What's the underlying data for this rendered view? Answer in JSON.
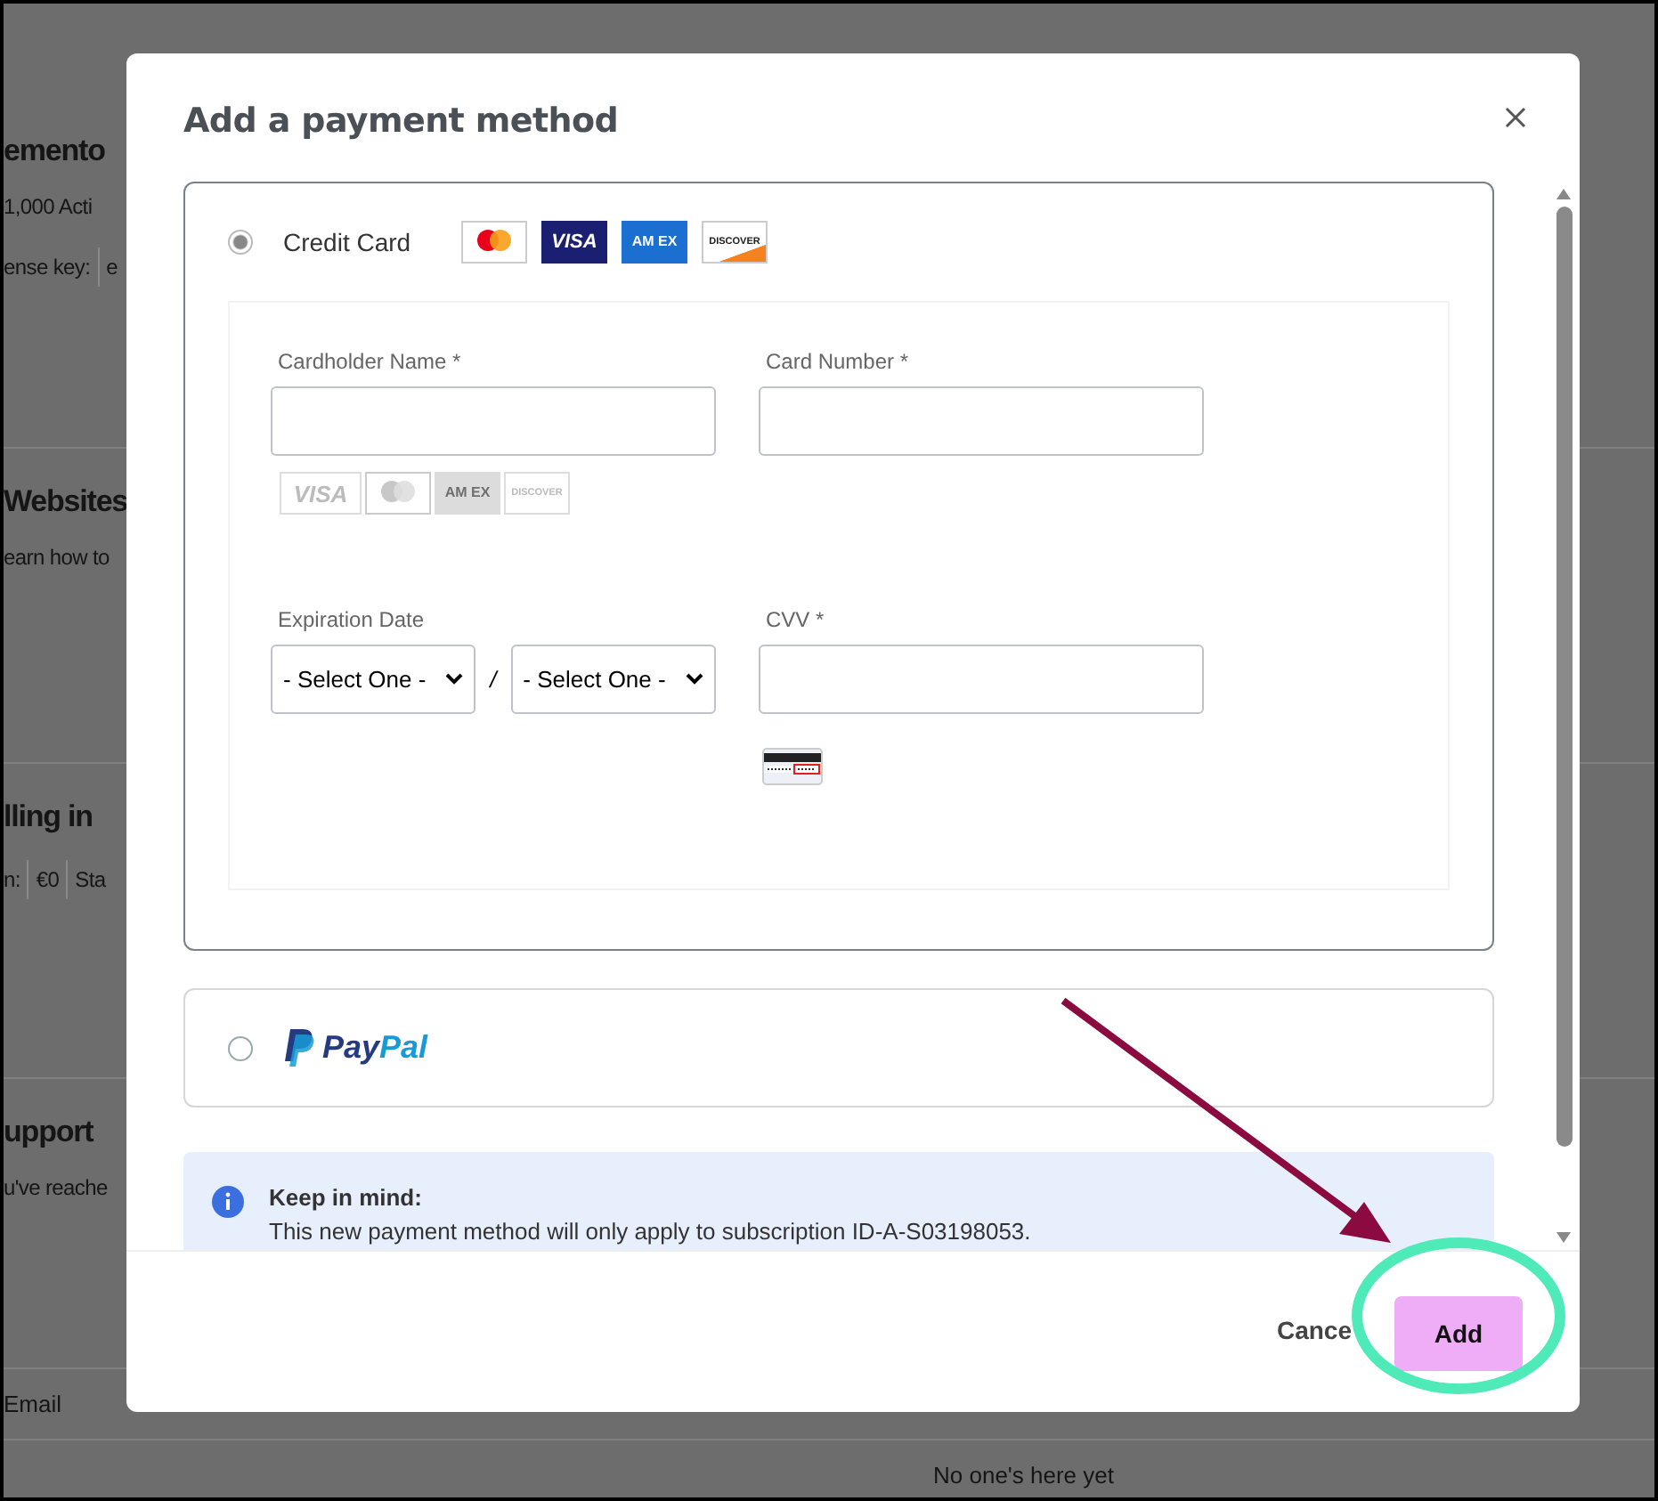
{
  "background_page": {
    "sections": [
      {
        "title": "emento",
        "rows": [
          [
            "1,000 Acti"
          ],
          [
            "ense key:",
            "e"
          ]
        ]
      },
      {
        "title": "Websites",
        "rows": [
          [
            "earn how to"
          ]
        ]
      },
      {
        "title": "lling in",
        "rows": [
          [
            "n:",
            "€0",
            "Sta"
          ]
        ]
      },
      {
        "title": "upport",
        "rows": [
          [
            "u've reache"
          ]
        ]
      }
    ],
    "table_header": "Email",
    "empty_text": "No one's here yet"
  },
  "dialog": {
    "title": "Add a payment method",
    "methods": [
      {
        "kind": "card",
        "label": "Credit Card",
        "selected": true,
        "brands": [
          {
            "kind": "mastercard"
          },
          {
            "kind": "visa",
            "text": "VISA"
          },
          {
            "kind": "amex",
            "text": "AM EX"
          },
          {
            "kind": "discover",
            "text": "DISCOVER"
          }
        ],
        "fields": [
          {
            "kind": "text",
            "label": "Cardholder Name *",
            "placeholder_icons": [
              {
                "kind": "visa",
                "text": "VISA"
              },
              {
                "kind": "mastercard"
              },
              {
                "kind": "amex",
                "text": "AM EX"
              },
              {
                "kind": "discover",
                "text": "DISCOVER"
              }
            ]
          },
          {
            "kind": "text",
            "label": "Card Number *"
          },
          {
            "kind": "date",
            "label": "Expiration Date",
            "month": "- Select One -",
            "separator": "/",
            "year": "- Select One -"
          },
          {
            "kind": "cvv",
            "label": "CVV *"
          }
        ]
      },
      {
        "kind": "paypal",
        "logo_parts": [
          "Pay",
          "Pal"
        ],
        "selected": false
      }
    ],
    "notice": {
      "title": "Keep in mind:",
      "text": "This new payment method will only apply to subscription ID-A-S03198053."
    },
    "buttons": [
      {
        "label": "Cance",
        "kind": "secondary"
      },
      {
        "label": "Add",
        "kind": "primary"
      }
    ]
  }
}
